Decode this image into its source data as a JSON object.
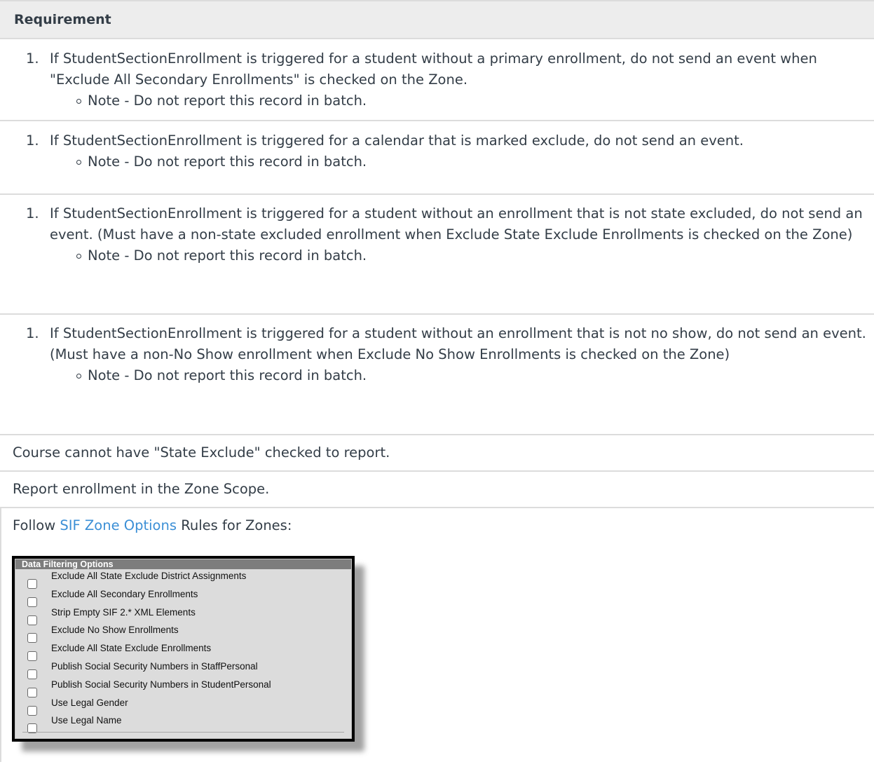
{
  "header": "Requirement",
  "rows": [
    {
      "item_number": "1.",
      "text": "If StudentSectionEnrollment is triggered for a student without a primary enrollment, do not send an event when \"Exclude All Secondary Enrollments\" is checked on the Zone.",
      "note": "Note - Do not report this record in batch."
    },
    {
      "item_number": "1.",
      "text": "If StudentSectionEnrollment is triggered for a calendar that is marked exclude, do not send an event.",
      "note": "Note - Do not report this record in batch."
    },
    {
      "item_number": "1.",
      "text": "If StudentSectionEnrollment is triggered for a student without an enrollment that is not state excluded, do not send an event. (Must have a non-state excluded enrollment when Exclude State Exclude Enrollments is checked on the Zone)",
      "note": "Note - Do not report this record in batch."
    },
    {
      "item_number": "1.",
      "text": "If StudentSectionEnrollment is triggered for a student without an enrollment that is not no show, do not send an event. (Must have a non-No Show enrollment when Exclude No Show Enrollments is checked on the Zone)",
      "note": "Note - Do not report this record in batch."
    }
  ],
  "course_rule": "Course cannot have \"State Exclude\" checked to report.",
  "scope_rule": "Report enrollment in the Zone Scope.",
  "follow": {
    "prefix": "Follow ",
    "link": "SIF Zone Options",
    "suffix": " Rules for Zones:"
  },
  "zone_options": {
    "title": "Data Filtering Options",
    "options": [
      {
        "label": "Exclude All State Exclude District Assignments",
        "checked": false
      },
      {
        "label": "Exclude All Secondary Enrollments",
        "checked": false
      },
      {
        "label": "Strip Empty SIF 2.* XML Elements",
        "checked": false
      },
      {
        "label": "Exclude No Show Enrollments",
        "checked": false
      },
      {
        "label": "Exclude All State Exclude Enrollments",
        "checked": false
      },
      {
        "label": "Publish Social Security Numbers in StaffPersonal",
        "checked": false
      },
      {
        "label": "Publish Social Security Numbers in StudentPersonal",
        "checked": false
      },
      {
        "label": "Use Legal Gender",
        "checked": false
      },
      {
        "label": "Use Legal Name",
        "checked": false
      }
    ]
  }
}
